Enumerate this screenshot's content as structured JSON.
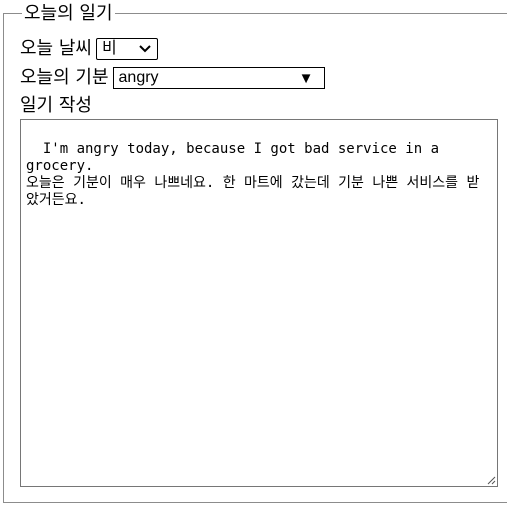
{
  "fieldset": {
    "legend": "오늘의 일기"
  },
  "weather": {
    "label": "오늘 날씨",
    "selected": "비",
    "icon": "chevron-down-icon"
  },
  "mood": {
    "label": "오늘의 기분",
    "selected": "angry",
    "icon": "triangle-down-icon"
  },
  "diary": {
    "label": "일기 작성",
    "text": "I'm angry today, because I got bad service in a grocery.\n오늘은 기분이 매우 나쁘네요. 한 마트에 갔는데 기분 나쁜 서비스를 받았거든요."
  },
  "colors": {
    "border": "#767676",
    "frame": "#8c8c8c"
  }
}
